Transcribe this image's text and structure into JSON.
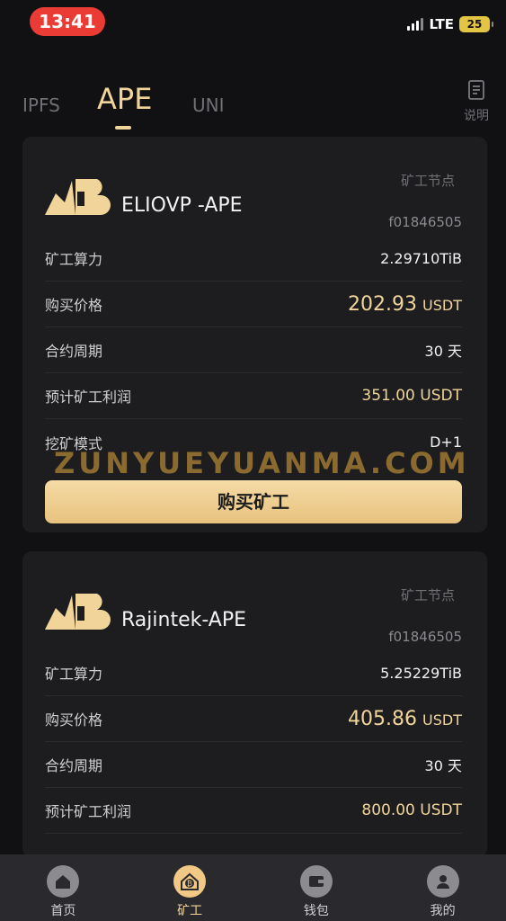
{
  "status_bar": {
    "time": "13:41",
    "network": "LTE",
    "battery": "25"
  },
  "tabs": [
    {
      "label": "IPFS",
      "active": false
    },
    {
      "label": "APE",
      "active": true
    },
    {
      "label": "UNI",
      "active": false
    }
  ],
  "help": {
    "label": "说明",
    "icon": "document-icon"
  },
  "cards": [
    {
      "name": "ELIOVP -APE",
      "node_label": "矿工节点",
      "node_id": "f01846505",
      "rows": [
        {
          "label": "矿工算力",
          "value": "2.29710TiB"
        },
        {
          "label": "购买价格",
          "value": "202.93",
          "unit": "USDT"
        },
        {
          "label": "合约周期",
          "value": "30 天"
        },
        {
          "label": "预计矿工利润",
          "value": "351.00 USDT"
        },
        {
          "label": "挖矿模式",
          "value": "D+1"
        }
      ],
      "button": "购买矿工"
    },
    {
      "name": "Rajintek-APE",
      "node_label": "矿工节点",
      "node_id": "f01846505",
      "rows": [
        {
          "label": "矿工算力",
          "value": "5.25229TiB"
        },
        {
          "label": "购买价格",
          "value": "405.86",
          "unit": "USDT"
        },
        {
          "label": "合约周期",
          "value": "30 天"
        },
        {
          "label": "预计矿工利润",
          "value": "800.00 USDT"
        }
      ]
    }
  ],
  "watermark": "ZUNYUEYUANMA.COM",
  "bottom_nav": [
    {
      "label": "首页",
      "icon": "home-icon",
      "active": false
    },
    {
      "label": "矿工",
      "icon": "bitcoin-icon",
      "active": true
    },
    {
      "label": "钱包",
      "icon": "wallet-icon",
      "active": false
    },
    {
      "label": "我的",
      "icon": "user-icon",
      "active": false
    }
  ],
  "colors": {
    "accent": "#f0d49a",
    "background": "#111114",
    "card": "#1d1d20",
    "time_pill": "#ea3b35"
  }
}
